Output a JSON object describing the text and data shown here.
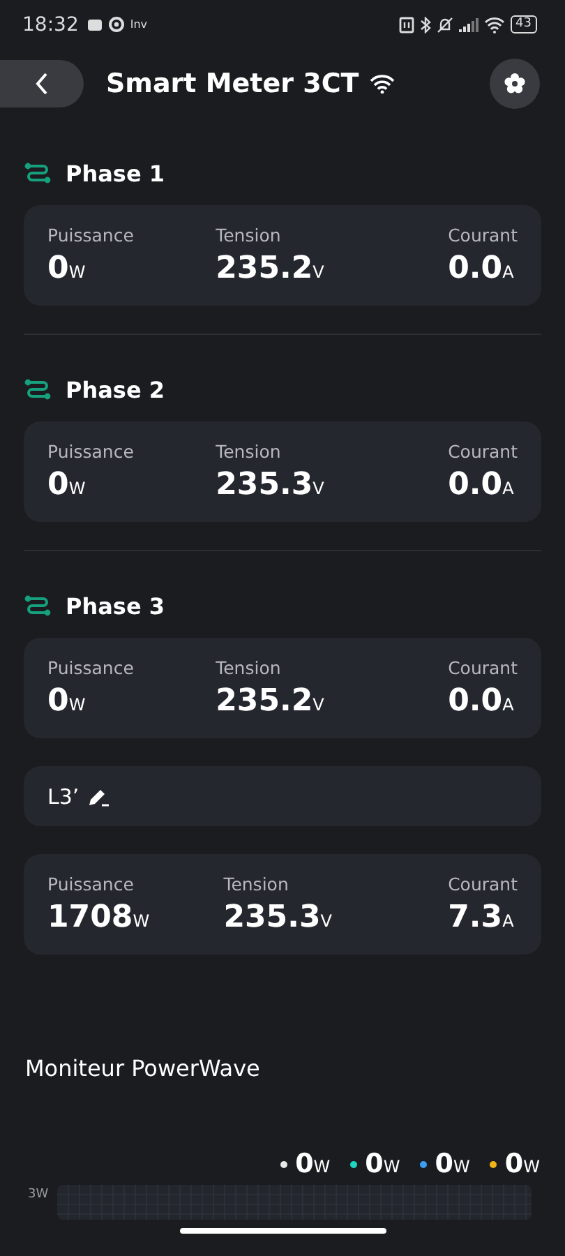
{
  "status_bar": {
    "time": "18:32",
    "app_label": "Inv",
    "battery": "43"
  },
  "header": {
    "title": "Smart Meter 3CT"
  },
  "sections": [
    {
      "kind": "phase",
      "title": "Phase 1",
      "metrics": [
        {
          "label": "Puissance",
          "value": "0",
          "unit": "W"
        },
        {
          "label": "Tension",
          "value": "235.2",
          "unit": "V"
        },
        {
          "label": "Courant",
          "value": "0.0",
          "unit": "A"
        }
      ]
    },
    {
      "kind": "phase",
      "title": "Phase 2",
      "metrics": [
        {
          "label": "Puissance",
          "value": "0",
          "unit": "W"
        },
        {
          "label": "Tension",
          "value": "235.3",
          "unit": "V"
        },
        {
          "label": "Courant",
          "value": "0.0",
          "unit": "A"
        }
      ]
    },
    {
      "kind": "phase",
      "title": "Phase 3",
      "metrics": [
        {
          "label": "Puissance",
          "value": "0",
          "unit": "W"
        },
        {
          "label": "Tension",
          "value": "235.2",
          "unit": "V"
        },
        {
          "label": "Courant",
          "value": "0.0",
          "unit": "A"
        }
      ]
    },
    {
      "kind": "sub",
      "title": "L3’",
      "metrics": [
        {
          "label": "Puissance",
          "value": "1708",
          "unit": "W"
        },
        {
          "label": "Tension",
          "value": "235.3",
          "unit": "V"
        },
        {
          "label": "Courant",
          "value": "7.3",
          "unit": "A"
        }
      ]
    }
  ],
  "monitor": {
    "title": "Moniteur PowerWave",
    "legend": [
      {
        "value": "0",
        "unit": "W",
        "color": "#e8e8e8"
      },
      {
        "value": "0",
        "unit": "W",
        "color": "#1fd6c1"
      },
      {
        "value": "0",
        "unit": "W",
        "color": "#3a9ff2"
      },
      {
        "value": "0",
        "unit": "W",
        "color": "#f2b518"
      }
    ],
    "axis_label": "3W"
  }
}
